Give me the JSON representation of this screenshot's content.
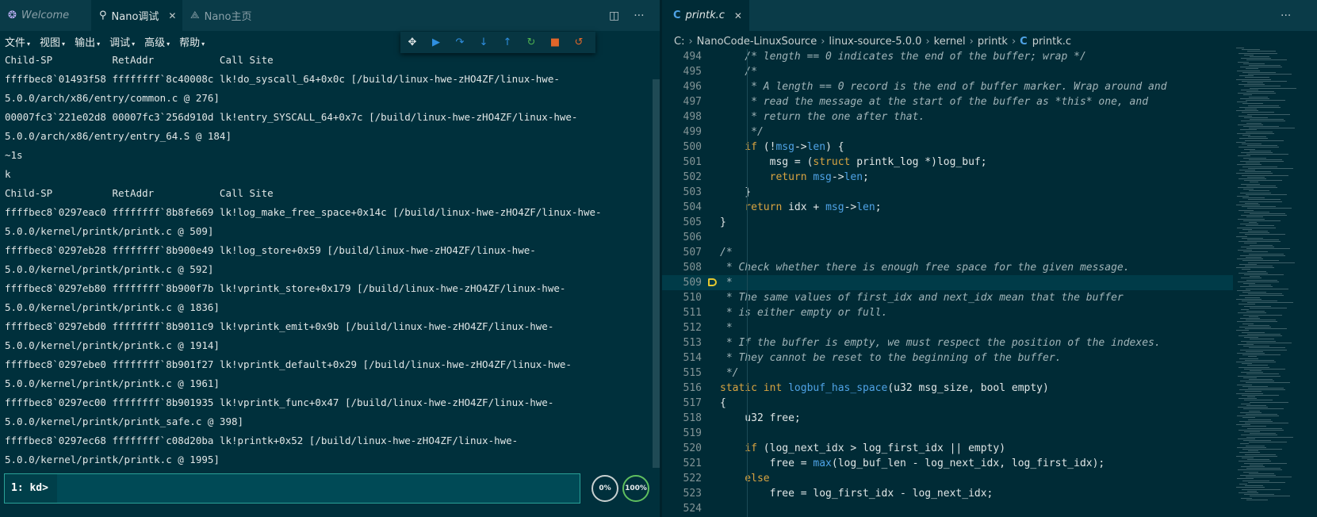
{
  "left_tabs": [
    {
      "label": "Welcome",
      "icon": "vscode-logo-icon"
    },
    {
      "label": "Nano调试",
      "icon": "debug-search-icon",
      "close": "✕"
    },
    {
      "label": "Nano主页",
      "icon": "nano-logo-icon"
    }
  ],
  "right_tabs": [
    {
      "label": "printk.c",
      "icon_text": "C",
      "close": "✕"
    }
  ],
  "tab_tools": {
    "split": "◫",
    "more": "···"
  },
  "menu": [
    "文件",
    "视图",
    "输出",
    "调试",
    "高级",
    "帮助"
  ],
  "menu_caret": "▾",
  "debug_toolbar": [
    {
      "name": "drag-handle-icon",
      "glyph": "✥",
      "color": "#e0e6e6"
    },
    {
      "name": "continue-icon",
      "glyph": "▶",
      "color": "#2f8fe0"
    },
    {
      "name": "step-over-icon",
      "glyph": "↷",
      "color": "#2f8fe0"
    },
    {
      "name": "step-into-icon",
      "glyph": "↓",
      "color": "#2f8fe0"
    },
    {
      "name": "step-out-icon",
      "glyph": "↑",
      "color": "#2f8fe0"
    },
    {
      "name": "restart-icon",
      "glyph": "↻",
      "color": "#4caf50"
    },
    {
      "name": "stop-icon",
      "glyph": "■",
      "color": "#e0662a"
    },
    {
      "name": "disconnect-icon",
      "glyph": "↺",
      "color": "#e0662a"
    }
  ],
  "console_lines": [
    "Child-SP          RetAddr           Call Site",
    "ffffbec8`01493f58 ffffffff`8c40008c lk!do_syscall_64+0x0c [/build/linux-hwe-zHO4ZF/linux-hwe-",
    "5.0.0/arch/x86/entry/common.c @ 276]",
    "00007fc3`221e02d8 00007fc3`256d910d lk!entry_SYSCALL_64+0x7c [/build/linux-hwe-zHO4ZF/linux-hwe-",
    "5.0.0/arch/x86/entry/entry_64.S @ 184]",
    "~1s",
    "k",
    "Child-SP          RetAddr           Call Site",
    "ffffbec8`0297eac0 ffffffff`8b8fe669 lk!log_make_free_space+0x14c [/build/linux-hwe-zHO4ZF/linux-hwe-",
    "5.0.0/kernel/printk/printk.c @ 509]",
    "ffffbec8`0297eb28 ffffffff`8b900e49 lk!log_store+0x59 [/build/linux-hwe-zHO4ZF/linux-hwe-",
    "5.0.0/kernel/printk/printk.c @ 592]",
    "ffffbec8`0297eb80 ffffffff`8b900f7b lk!vprintk_store+0x179 [/build/linux-hwe-zHO4ZF/linux-hwe-",
    "5.0.0/kernel/printk/printk.c @ 1836]",
    "ffffbec8`0297ebd0 ffffffff`8b9011c9 lk!vprintk_emit+0x9b [/build/linux-hwe-zHO4ZF/linux-hwe-",
    "5.0.0/kernel/printk/printk.c @ 1914]",
    "ffffbec8`0297ebe0 ffffffff`8b901f27 lk!vprintk_default+0x29 [/build/linux-hwe-zHO4ZF/linux-hwe-",
    "5.0.0/kernel/printk/printk.c @ 1961]",
    "ffffbec8`0297ec00 ffffffff`8b901935 lk!vprintk_func+0x47 [/build/linux-hwe-zHO4ZF/linux-hwe-",
    "5.0.0/kernel/printk/printk_safe.c @ 398]",
    "ffffbec8`0297ec68 ffffffff`c08d20ba lk!printk+0x52 [/build/linux-hwe-zHO4ZF/linux-hwe-",
    "5.0.0/kernel/printk/printk.c @ 1995]"
  ],
  "command": {
    "label": "1: kd>",
    "value": ""
  },
  "gauges": [
    "0%",
    "100%"
  ],
  "breadcrumb": [
    "C:",
    "NanoCode-LinuxSource",
    "linux-source-5.0.0",
    "kernel",
    "printk",
    "printk.c"
  ],
  "breadcrumb_sep": "›",
  "breadcrumb_file_icon": "C",
  "code_lines": [
    {
      "n": "494",
      "parts": [
        [
          "cm",
          "    /* length == 0 indicates the end of the buffer; wrap */"
        ]
      ]
    },
    {
      "n": "495",
      "parts": [
        [
          "cm",
          "    /*"
        ]
      ]
    },
    {
      "n": "496",
      "parts": [
        [
          "cm",
          "     * A length == 0 record is the end of buffer marker. Wrap around and"
        ]
      ]
    },
    {
      "n": "497",
      "parts": [
        [
          "cm",
          "     * read the message at the start of the buffer as *this* one, and"
        ]
      ]
    },
    {
      "n": "498",
      "parts": [
        [
          "cm",
          "     * return the one after that."
        ]
      ]
    },
    {
      "n": "499",
      "parts": [
        [
          "cm",
          "     */"
        ]
      ]
    },
    {
      "n": "500",
      "parts": [
        [
          "kw",
          "    if"
        ],
        [
          "",
          " (!"
        ],
        [
          "fn",
          "msg"
        ],
        [
          "",
          "->"
        ],
        [
          "fn",
          "len"
        ],
        [
          "",
          ") {"
        ]
      ]
    },
    {
      "n": "501",
      "parts": [
        [
          "",
          "        msg = ("
        ],
        [
          "kw",
          "struct"
        ],
        [
          "",
          " printk_log *)log_buf;"
        ]
      ]
    },
    {
      "n": "502",
      "parts": [
        [
          "kw",
          "        return"
        ],
        [
          "",
          " "
        ],
        [
          "fn",
          "msg"
        ],
        [
          "",
          "->"
        ],
        [
          "fn",
          "len"
        ],
        [
          "",
          ";"
        ]
      ]
    },
    {
      "n": "503",
      "parts": [
        [
          "",
          "    }"
        ]
      ]
    },
    {
      "n": "504",
      "parts": [
        [
          "kw",
          "    return"
        ],
        [
          "",
          " idx + "
        ],
        [
          "fn",
          "msg"
        ],
        [
          "",
          "->"
        ],
        [
          "fn",
          "len"
        ],
        [
          "",
          ";"
        ]
      ]
    },
    {
      "n": "505",
      "parts": [
        [
          "",
          "}"
        ]
      ]
    },
    {
      "n": "506",
      "parts": []
    },
    {
      "n": "507",
      "parts": [
        [
          "cm",
          "/*"
        ]
      ]
    },
    {
      "n": "508",
      "parts": [
        [
          "cm",
          " * Check whether there is enough free space for the given message."
        ]
      ]
    },
    {
      "n": "509",
      "parts": [
        [
          "cm",
          " *"
        ]
      ],
      "breakpoint": true,
      "current": true
    },
    {
      "n": "510",
      "parts": [
        [
          "cm",
          " * The same values of first_idx and next_idx mean that the buffer"
        ]
      ]
    },
    {
      "n": "511",
      "parts": [
        [
          "cm",
          " * is either empty or full."
        ]
      ]
    },
    {
      "n": "512",
      "parts": [
        [
          "cm",
          " *"
        ]
      ]
    },
    {
      "n": "513",
      "parts": [
        [
          "cm",
          " * If the buffer is empty, we must respect the position of the indexes."
        ]
      ]
    },
    {
      "n": "514",
      "parts": [
        [
          "cm",
          " * They cannot be reset to the beginning of the buffer."
        ]
      ]
    },
    {
      "n": "515",
      "parts": [
        [
          "cm",
          " */"
        ]
      ]
    },
    {
      "n": "516",
      "parts": [
        [
          "kw",
          "static"
        ],
        [
          "",
          " "
        ],
        [
          "kw",
          "int"
        ],
        [
          "",
          " "
        ],
        [
          "fn",
          "logbuf_has_space"
        ],
        [
          "",
          "(u32 msg_size, bool empty)"
        ]
      ]
    },
    {
      "n": "517",
      "parts": [
        [
          "",
          "{"
        ]
      ]
    },
    {
      "n": "518",
      "parts": [
        [
          "",
          "    u32 free;"
        ]
      ]
    },
    {
      "n": "519",
      "parts": []
    },
    {
      "n": "520",
      "parts": [
        [
          "kw",
          "    if"
        ],
        [
          "",
          " (log_next_idx > log_first_idx || empty)"
        ]
      ]
    },
    {
      "n": "521",
      "parts": [
        [
          "",
          "        free = "
        ],
        [
          "fn",
          "max"
        ],
        [
          "",
          "(log_buf_len - log_next_idx, log_first_idx);"
        ]
      ]
    },
    {
      "n": "522",
      "parts": [
        [
          "kw",
          "    else"
        ]
      ]
    },
    {
      "n": "523",
      "parts": [
        [
          "",
          "        free = log_first_idx - log_next_idx;"
        ]
      ]
    },
    {
      "n": "524",
      "parts": []
    }
  ],
  "colors": {
    "background": "#002b36",
    "tabbar": "#0a3b48",
    "keyword": "#d9a441",
    "function": "#4fa3e6",
    "comment": "#a0b4b8",
    "breakpoint": "#e5c830",
    "accent": "#2aa198"
  }
}
